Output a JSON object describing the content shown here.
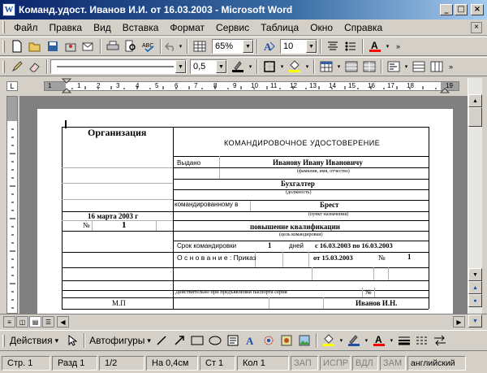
{
  "window": {
    "title": "Команд.удост. Иванов И.И. от 16.03.2003 - Microsoft Word",
    "icon": "word-app-icon",
    "minimize": "_",
    "maximize": "□",
    "close": "×"
  },
  "menu": {
    "items": [
      "Файл",
      "Правка",
      "Вид",
      "Вставка",
      "Формат",
      "Сервис",
      "Таблица",
      "Окно",
      "Справка"
    ],
    "close_doc": "×"
  },
  "toolbar_standard": {
    "zoom": "65%",
    "font_size": "10"
  },
  "toolbar_tables": {
    "line_weight": "0,5"
  },
  "ruler": {
    "numbers": [
      "1",
      "1",
      "2",
      "3",
      "4",
      "5",
      "6",
      "7",
      "8",
      "9",
      "10",
      "11",
      "12",
      "13",
      "14",
      "15",
      "16",
      "17",
      "18",
      "19"
    ]
  },
  "document": {
    "org": "Организация",
    "title": "КОМАНДИРОВОЧНОЕ УДОСТОВЕРЕНИЕ",
    "issued_label": "Выдано",
    "issued_to": "Иванову Ивану Ивановичу",
    "issued_caption": "(фамилия, имя, отчество)",
    "position": "Бухгалтер",
    "position_caption": "(должность)",
    "sent_label": "командированному в",
    "destination": "Брест",
    "destination_caption": "(пункт назначения)",
    "date": "16 марта 2003 г",
    "no_label": "№",
    "number": "1",
    "purpose": "повышение квалификации",
    "purpose_caption": "(цель командировки)",
    "term_label": "Срок командировки",
    "term_days": "1",
    "days_label": "дней",
    "period": "с 16.03.2003 по 16.03.2003",
    "basis_label": "О с н о в а н и е : Приказ",
    "basis_date": "от 15.03.2003",
    "basis_no_label": "№",
    "basis_no": "1",
    "passport_label": "Действительно при предъявлении паспорта серия",
    "passport_no_label": "№",
    "stamp": "М.П",
    "signer": "Иванов И.Н."
  },
  "drawing": {
    "actions": "Действия",
    "autoshapes": "Автофигуры"
  },
  "status": {
    "page": "Стр. 1",
    "section": "Разд 1",
    "pages": "1/2",
    "at": "На 0,4см",
    "line": "Ст 1",
    "col": "Кол 1",
    "rec": "ЗАП",
    "trk": "ИСПР",
    "ext": "ВДЛ",
    "ovr": "ЗАМ",
    "lang": "английский"
  },
  "colors": {
    "title_start": "#0a246a",
    "title_end": "#a6caf0",
    "chrome": "#d4d0c8",
    "workspace": "#808080",
    "font_color_bar": "#ff0000",
    "highlight_bar": "#ffff00"
  }
}
